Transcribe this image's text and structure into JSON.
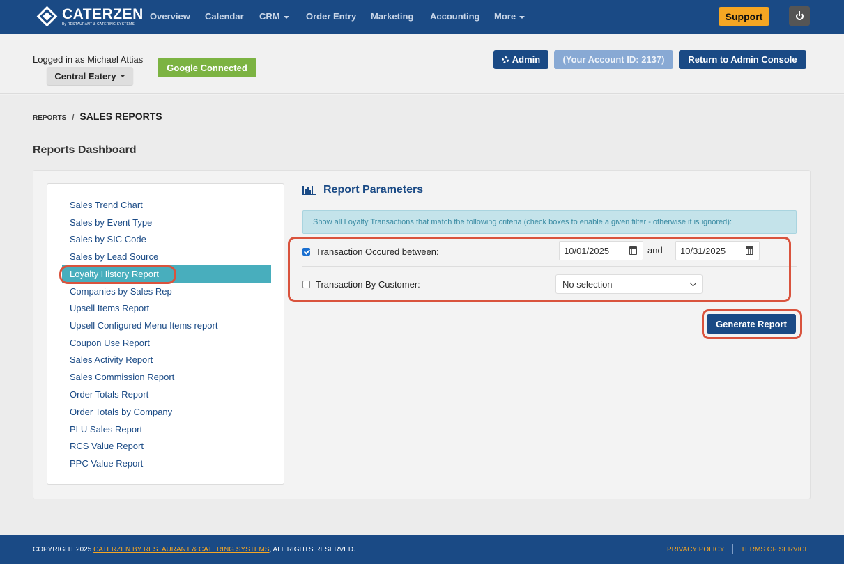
{
  "nav": {
    "brand_name": "CATERZEN",
    "brand_tagline": "By RESTAURANT & CATERING SYSTEMS",
    "items": [
      "Overview",
      "Calendar",
      "CRM",
      "Order Entry",
      "Marketing",
      "Accounting",
      "More"
    ],
    "support_label": "Support",
    "power_icon": "power-icon"
  },
  "account": {
    "logged_in_text": "Logged in as Michael Attias",
    "location": "Central Eatery",
    "google_label": "Google Connected",
    "admin_label": "Admin",
    "account_id_label": "(Your Account ID: 2137)",
    "return_label": "Return to Admin Console"
  },
  "breadcrumb": {
    "parent": "REPORTS",
    "separator": "/",
    "current": "SALES REPORTS"
  },
  "dashboard_title": "Reports Dashboard",
  "sidebar": {
    "items": [
      "Sales Trend Chart",
      "Sales by Event Type",
      "Sales by SIC Code",
      "Sales by Lead Source",
      "Loyalty History Report",
      "Companies by Sales Rep",
      "Upsell Items Report",
      "Upsell Configured Menu Items report",
      "Coupon Use Report",
      "Sales Activity Report",
      "Sales Commission Report",
      "Order Totals Report",
      "Order Totals by Company",
      "PLU Sales Report",
      "RCS Value Report",
      "PPC Value Report"
    ],
    "active_index": 4
  },
  "params": {
    "title": "Report Parameters",
    "info_text": "Show all Loyalty Transactions that match the following criteria (check boxes to enable a given filter - otherwise it is ignored):",
    "filter1_label": "Transaction Occured between:",
    "filter1_checked": true,
    "date_from": "10/01/2025",
    "and_label": "and",
    "date_to": "10/31/2025",
    "filter2_label": "Transaction By Customer:",
    "filter2_checked": false,
    "customer_value": "No selection",
    "generate_label": "Generate Report"
  },
  "footer": {
    "copyright_prefix": "COPYRIGHT 2025 ",
    "copyright_link": "CATERZEN BY RESTAURANT & CATERING SYSTEMS",
    "copyright_suffix": ", ALL RIGHTS RESERVED.",
    "privacy": "PRIVACY POLICY",
    "terms": "TERMS OF SERVICE"
  },
  "colors": {
    "nav_bg": "#1a4a85",
    "support": "#f5a623",
    "google": "#7cb342",
    "active_item": "#48aebd",
    "highlight": "#d9533d"
  }
}
